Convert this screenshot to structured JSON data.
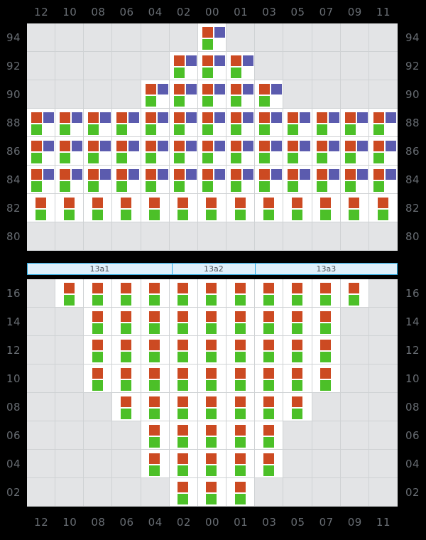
{
  "columns": [
    "12",
    "10",
    "08",
    "06",
    "04",
    "02",
    "00",
    "01",
    "03",
    "05",
    "07",
    "09",
    "11"
  ],
  "colors": {
    "orange": "#cc4a22",
    "purple": "#5b5bae",
    "green": "#4cc028",
    "empty_cell": "#e3e4e6",
    "filled_cell": "#ffffff",
    "grid_line": "#cfd2d4",
    "background": "#000000",
    "band_fill": "#dff0fb",
    "band_border": "#2aa8e0",
    "label_text": "#686d73"
  },
  "segments": [
    {
      "label": "13a1",
      "width_fraction": 0.392
    },
    {
      "label": "13a2",
      "width_fraction": 0.225
    },
    {
      "label": "13a3",
      "width_fraction": 0.383
    }
  ],
  "top_grid": {
    "row_labels": [
      "94",
      "92",
      "90",
      "88",
      "86",
      "84",
      "82",
      "80"
    ],
    "rows": [
      {
        "label": "94",
        "cells": [
          [],
          [],
          [],
          [],
          [],
          [],
          [
            "orange",
            "purple",
            "green"
          ],
          [],
          [],
          [],
          [],
          [],
          []
        ]
      },
      {
        "label": "92",
        "cells": [
          [],
          [],
          [],
          [],
          [],
          [
            "orange",
            "purple",
            "green"
          ],
          [
            "orange",
            "purple",
            "green"
          ],
          [
            "orange",
            "purple",
            "green"
          ],
          [],
          [],
          [],
          [],
          []
        ]
      },
      {
        "label": "90",
        "cells": [
          [],
          [],
          [],
          [],
          [
            "orange",
            "purple",
            "green"
          ],
          [
            "orange",
            "purple",
            "green"
          ],
          [
            "orange",
            "purple",
            "green"
          ],
          [
            "orange",
            "purple",
            "green"
          ],
          [
            "orange",
            "purple",
            "green"
          ],
          [],
          [],
          [],
          []
        ]
      },
      {
        "label": "88",
        "cells": [
          [
            "orange",
            "purple",
            "green"
          ],
          [
            "orange",
            "purple",
            "green"
          ],
          [
            "orange",
            "purple",
            "green"
          ],
          [
            "orange",
            "purple",
            "green"
          ],
          [
            "orange",
            "purple",
            "green"
          ],
          [
            "orange",
            "purple",
            "green"
          ],
          [
            "orange",
            "purple",
            "green"
          ],
          [
            "orange",
            "purple",
            "green"
          ],
          [
            "orange",
            "purple",
            "green"
          ],
          [
            "orange",
            "purple",
            "green"
          ],
          [
            "orange",
            "purple",
            "green"
          ],
          [
            "orange",
            "purple",
            "green"
          ],
          [
            "orange",
            "purple",
            "green"
          ]
        ]
      },
      {
        "label": "86",
        "cells": [
          [
            "orange",
            "purple",
            "green"
          ],
          [
            "orange",
            "purple",
            "green"
          ],
          [
            "orange",
            "purple",
            "green"
          ],
          [
            "orange",
            "purple",
            "green"
          ],
          [
            "orange",
            "purple",
            "green"
          ],
          [
            "orange",
            "purple",
            "green"
          ],
          [
            "orange",
            "purple",
            "green"
          ],
          [
            "orange",
            "purple",
            "green"
          ],
          [
            "orange",
            "purple",
            "green"
          ],
          [
            "orange",
            "purple",
            "green"
          ],
          [
            "orange",
            "purple",
            "green"
          ],
          [
            "orange",
            "purple",
            "green"
          ],
          [
            "orange",
            "purple",
            "green"
          ]
        ]
      },
      {
        "label": "84",
        "cells": [
          [
            "orange",
            "purple",
            "green"
          ],
          [
            "orange",
            "purple",
            "green"
          ],
          [
            "orange",
            "purple",
            "green"
          ],
          [
            "orange",
            "purple",
            "green"
          ],
          [
            "orange",
            "purple",
            "green"
          ],
          [
            "orange",
            "purple",
            "green"
          ],
          [
            "orange",
            "purple",
            "green"
          ],
          [
            "orange",
            "purple",
            "green"
          ],
          [
            "orange",
            "purple",
            "green"
          ],
          [
            "orange",
            "purple",
            "green"
          ],
          [
            "orange",
            "purple",
            "green"
          ],
          [
            "orange",
            "purple",
            "green"
          ],
          [
            "orange",
            "purple",
            "green"
          ]
        ]
      },
      {
        "label": "82",
        "cells": [
          [
            "orange_c",
            "green_c"
          ],
          [
            "orange_c",
            "green_c"
          ],
          [
            "orange_c",
            "green_c"
          ],
          [
            "orange_c",
            "green_c"
          ],
          [
            "orange_c",
            "green_c"
          ],
          [
            "orange_c",
            "green_c"
          ],
          [
            "orange_c",
            "green_c"
          ],
          [
            "orange_c",
            "green_c"
          ],
          [
            "orange_c",
            "green_c"
          ],
          [
            "orange_c",
            "green_c"
          ],
          [
            "orange_c",
            "green_c"
          ],
          [
            "orange_c",
            "green_c"
          ],
          [
            "orange_c",
            "green_c"
          ]
        ]
      },
      {
        "label": "80",
        "cells": [
          [],
          [],
          [],
          [],
          [],
          [],
          [],
          [],
          [],
          [],
          [],
          [],
          []
        ]
      }
    ]
  },
  "bottom_grid": {
    "row_labels": [
      "16",
      "14",
      "12",
      "10",
      "08",
      "06",
      "04",
      "02"
    ],
    "rows": [
      {
        "label": "16",
        "cells": [
          [],
          [
            "orange_c",
            "green_c"
          ],
          [
            "orange_c",
            "green_c"
          ],
          [
            "orange_c",
            "green_c"
          ],
          [
            "orange_c",
            "green_c"
          ],
          [
            "orange_c",
            "green_c"
          ],
          [
            "orange_c",
            "green_c"
          ],
          [
            "orange_c",
            "green_c"
          ],
          [
            "orange_c",
            "green_c"
          ],
          [
            "orange_c",
            "green_c"
          ],
          [
            "orange_c",
            "green_c"
          ],
          [
            "orange_c",
            "green_c"
          ],
          []
        ]
      },
      {
        "label": "14",
        "cells": [
          [],
          [],
          [
            "orange_c",
            "green_c"
          ],
          [
            "orange_c",
            "green_c"
          ],
          [
            "orange_c",
            "green_c"
          ],
          [
            "orange_c",
            "green_c"
          ],
          [
            "orange_c",
            "green_c"
          ],
          [
            "orange_c",
            "green_c"
          ],
          [
            "orange_c",
            "green_c"
          ],
          [
            "orange_c",
            "green_c"
          ],
          [
            "orange_c",
            "green_c"
          ],
          [],
          []
        ]
      },
      {
        "label": "12",
        "cells": [
          [],
          [],
          [
            "orange_c",
            "green_c"
          ],
          [
            "orange_c",
            "green_c"
          ],
          [
            "orange_c",
            "green_c"
          ],
          [
            "orange_c",
            "green_c"
          ],
          [
            "orange_c",
            "green_c"
          ],
          [
            "orange_c",
            "green_c"
          ],
          [
            "orange_c",
            "green_c"
          ],
          [
            "orange_c",
            "green_c"
          ],
          [
            "orange_c",
            "green_c"
          ],
          [],
          []
        ]
      },
      {
        "label": "10",
        "cells": [
          [],
          [],
          [
            "orange_c",
            "green_c"
          ],
          [
            "orange_c",
            "green_c"
          ],
          [
            "orange_c",
            "green_c"
          ],
          [
            "orange_c",
            "green_c"
          ],
          [
            "orange_c",
            "green_c"
          ],
          [
            "orange_c",
            "green_c"
          ],
          [
            "orange_c",
            "green_c"
          ],
          [
            "orange_c",
            "green_c"
          ],
          [
            "orange_c",
            "green_c"
          ],
          [],
          []
        ]
      },
      {
        "label": "08",
        "cells": [
          [],
          [],
          [],
          [
            "orange_c",
            "green_c"
          ],
          [
            "orange_c",
            "green_c"
          ],
          [
            "orange_c",
            "green_c"
          ],
          [
            "orange_c",
            "green_c"
          ],
          [
            "orange_c",
            "green_c"
          ],
          [
            "orange_c",
            "green_c"
          ],
          [
            "orange_c",
            "green_c"
          ],
          [],
          [],
          []
        ]
      },
      {
        "label": "06",
        "cells": [
          [],
          [],
          [],
          [],
          [
            "orange_c",
            "green_c"
          ],
          [
            "orange_c",
            "green_c"
          ],
          [
            "orange_c",
            "green_c"
          ],
          [
            "orange_c",
            "green_c"
          ],
          [
            "orange_c",
            "green_c"
          ],
          [],
          [],
          [],
          []
        ]
      },
      {
        "label": "04",
        "cells": [
          [],
          [],
          [],
          [],
          [
            "orange_c",
            "green_c"
          ],
          [
            "orange_c",
            "green_c"
          ],
          [
            "orange_c",
            "green_c"
          ],
          [
            "orange_c",
            "green_c"
          ],
          [
            "orange_c",
            "green_c"
          ],
          [],
          [],
          [],
          []
        ]
      },
      {
        "label": "02",
        "cells": [
          [],
          [],
          [],
          [],
          [],
          [
            "orange_c",
            "green_c"
          ],
          [
            "orange_c",
            "green_c"
          ],
          [
            "orange_c",
            "green_c"
          ],
          [],
          [],
          [],
          [],
          []
        ]
      }
    ]
  }
}
